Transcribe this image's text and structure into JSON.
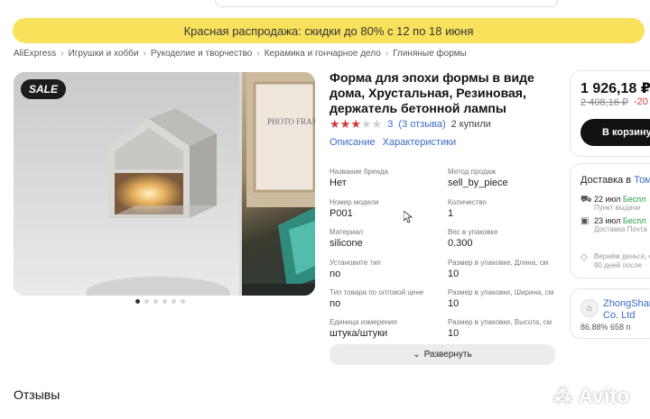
{
  "promo": {
    "text": "Красная распродажа: скидки до 80% с 12 по 18 июня"
  },
  "breadcrumbs": [
    "AliExpress",
    "Игрушки и хобби",
    "Рукоделие и творчество",
    "Керамика и гончарное дело",
    "Глиняные формы"
  ],
  "gallery": {
    "badge": "SALE",
    "photo_text": "PHOTO FRAME",
    "dots_count": 6,
    "active_dot": 0
  },
  "product": {
    "title": "Форма для эпохи формы в виде дома, Хрустальная, Резиновая, держатель бетонной лампы",
    "rating": 3,
    "rating_max": 5,
    "rating_value": "3",
    "reviews_link": "(3 отзыва)",
    "sold": "2 купили"
  },
  "tabs": {
    "description": "Описание",
    "specs": "Характеристики"
  },
  "specs": [
    {
      "label": "Название бренда",
      "value": "Нет"
    },
    {
      "label": "Метод продаж",
      "value": "sell_by_piece"
    },
    {
      "label": "Номер модели",
      "value": "P001"
    },
    {
      "label": "Количество",
      "value": "1"
    },
    {
      "label": "Материал",
      "value": "silicone"
    },
    {
      "label": "Вес в упаковке",
      "value": "0.300"
    },
    {
      "label": "Установите тип",
      "value": "no"
    },
    {
      "label": "Размер в упаковке, Длина, см",
      "value": "10"
    },
    {
      "label": "Тип товара по оптовой цене",
      "value": "no"
    },
    {
      "label": "Размер в упаковке, Ширина, см",
      "value": "10"
    },
    {
      "label": "Единица измерения",
      "value": "штука/штуки"
    },
    {
      "label": "Размер в упаковке, Высота, см",
      "value": "10"
    }
  ],
  "expand_button": "Развернуть",
  "reviews_heading": "Отзывы",
  "price": {
    "current": "1 926,18 ₽",
    "old": "2 408,16 ₽",
    "discount": "-20",
    "cart_button": "В корзину"
  },
  "shipping": {
    "title": "Доставка в",
    "city": "Том",
    "row1": {
      "date": "22 июл",
      "tag": "Беспл",
      "note": "Пункт выдачи"
    },
    "row2": {
      "date": "23 июл",
      "tag": "Беспл",
      "note": "Доставка Почта"
    },
    "note_line1": "Вернём деньги, если",
    "note_line2": "90 дней после"
  },
  "store": {
    "name_line1": "ZhongShan",
    "name_line2": "Co. Ltd",
    "stats": "86.88%  658 п"
  },
  "watermark": "Avito",
  "colors": {
    "promo": "#f9e15c",
    "link": "#3a6bcc",
    "star": "#d43b3b",
    "sale_badge": "#1c1c1c",
    "button": "#111111"
  }
}
